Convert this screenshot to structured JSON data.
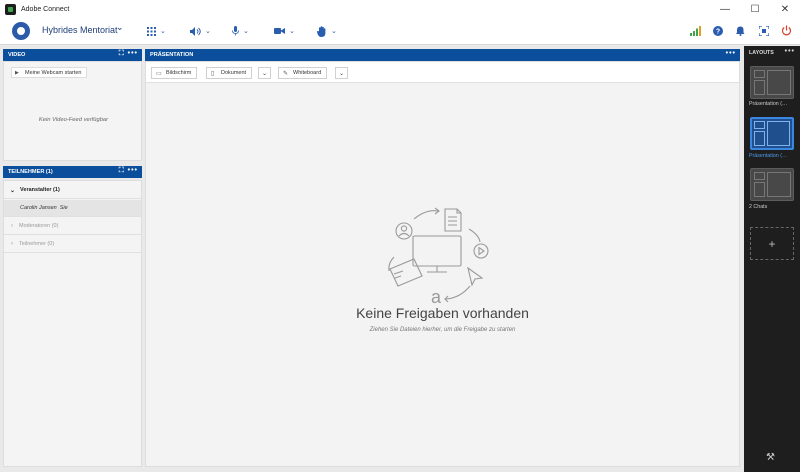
{
  "window": {
    "title": "Adobe Connect",
    "buttons": {
      "minimize": "—",
      "maximize": "☐",
      "close": "✕"
    }
  },
  "appbar": {
    "room_name": "Hybrides Mentoriat",
    "room_chevron": "⌄",
    "status_icons": [
      "signal-bars-icon",
      "help-icon",
      "bell-icon",
      "fullscreen-icon",
      "power-icon"
    ]
  },
  "video": {
    "header": "VIDEO",
    "webcam_button": "Meine Webcam starten",
    "no_feed": "Kein Video-Feed verfügbar"
  },
  "attendees": {
    "header": "TEILNEHMER  (1)",
    "groups": [
      {
        "label": "Veranstalter (1)",
        "expanded": true,
        "members": [
          {
            "name": "Carolin Jansen",
            "suffix": "Sie"
          }
        ]
      },
      {
        "label": "Moderatoren (0)",
        "expanded": false
      },
      {
        "label": "Teilnehmer (0)",
        "expanded": false
      }
    ]
  },
  "presentation": {
    "header": "PRÄSENTATION",
    "toolbar": {
      "screen": "Bildschirm",
      "document": "Dokument",
      "whiteboard": "Whiteboard"
    },
    "empty_title": "Keine Freigaben vorhanden",
    "empty_subtitle": "Ziehen Sie Dateien hierher, um die Freigabe zu starten"
  },
  "layouts": {
    "header": "LAYOUTS",
    "items": [
      {
        "label": "Präsentation (…",
        "active": false
      },
      {
        "label": "Präsentation (…",
        "active": true
      },
      {
        "label": "2 Chats",
        "active": false
      }
    ],
    "add_label": "+"
  },
  "colors": {
    "brand_blue": "#0b4f9c",
    "accent_blue": "#2a5db0",
    "dark_sidebar": "#1e1e1e",
    "power_red": "#d9412b",
    "signal_green": "#3fa34d"
  }
}
